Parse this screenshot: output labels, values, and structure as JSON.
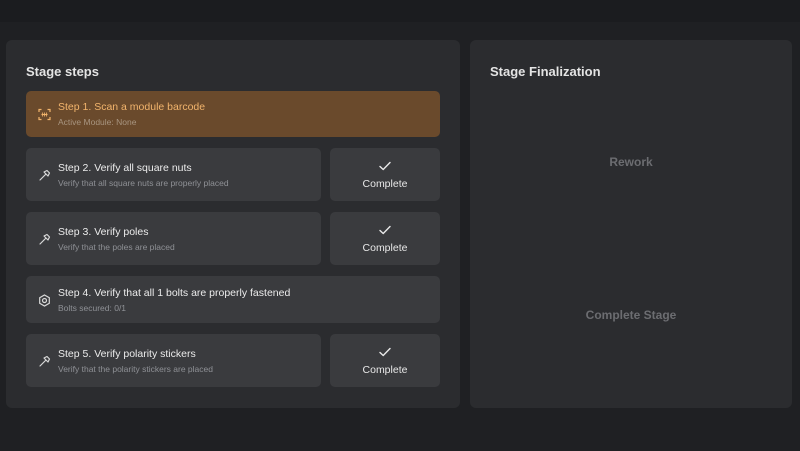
{
  "stage_steps": {
    "title": "Stage steps",
    "steps": [
      {
        "title": "Step 1. Scan a module barcode",
        "subtitle": "Active Module: None",
        "icon": "barcode-scan-icon",
        "active": true
      },
      {
        "title": "Step 2. Verify all square nuts",
        "subtitle": "Verify that all square nuts are properly placed",
        "icon": "hammer-icon",
        "button": "Complete"
      },
      {
        "title": "Step 3. Verify poles",
        "subtitle": "Verify that the poles are placed",
        "icon": "hammer-icon",
        "button": "Complete"
      },
      {
        "title": "Step 4. Verify that all 1 bolts are properly fastened",
        "subtitle": "Bolts secured: 0/1",
        "icon": "hex-nut-icon"
      },
      {
        "title": "Step 5. Verify polarity stickers",
        "subtitle": "Verify that the polarity stickers are placed",
        "icon": "hammer-icon",
        "button": "Complete"
      }
    ]
  },
  "finalization": {
    "title": "Stage Finalization",
    "rework_label": "Rework",
    "complete_stage_label": "Complete Stage"
  },
  "colors": {
    "active_step_bg": "#6a4a2c",
    "active_step_text": "#f2b46c",
    "panel_bg": "#2b2c2f",
    "card_bg": "#3a3b3e"
  }
}
